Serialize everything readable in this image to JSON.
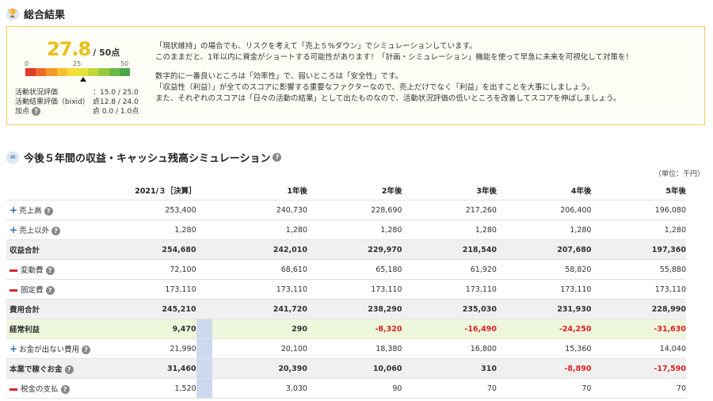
{
  "summary": {
    "title": "総合結果",
    "score": "27.8",
    "score_suffix": "/ 50点",
    "gauge_min": "0",
    "gauge_mid": "25",
    "gauge_max": "50",
    "score_fraction": 0.556,
    "metrics": [
      {
        "label": "活動状況評価",
        "value": "：15.0 / 25.0点"
      },
      {
        "label": "活動結果評価（bixid）",
        "value": "：12.8 / 24.0点"
      },
      {
        "label": "加点",
        "value": "：  0.0 /  1.0点"
      }
    ],
    "messages": [
      "「現状維持」の場合でも、リスクを考えて「売上５%ダウン」でシミュレーションしています。",
      "このままだと、1年以内に資金がショートする可能性があります！「計画・シミュレーション」機能を使って早急に未来を可視化して対策を！",
      "",
      "数字的に一番良いところは「効率性」で、弱いところは「安全性」です。",
      "「収益性（利益）」が全てのスコアに影響する重要なファクターなので、売上だけでなく「利益」を出すことを大事にしましょう。",
      "また、それぞれのスコアは「日々の活動の結果」として出たものなので、活動状況評価の低いところを改善してスコアを伸ばしましょう。"
    ]
  },
  "simulation": {
    "title": "今後５年間の収益・キャッシュ残高シミュレーション",
    "unit": "（単位：千円）",
    "headers": [
      "2021/３［決算］",
      "1年後",
      "2年後",
      "3年後",
      "4年後",
      "5年後"
    ],
    "rows": [
      {
        "label": "売上高",
        "icon": "plus",
        "help": true,
        "style": "",
        "values": [
          "253,400",
          "240,730",
          "228,690",
          "217,260",
          "206,400",
          "196,080"
        ]
      },
      {
        "label": "売上以外",
        "icon": "plus",
        "help": true,
        "style": "",
        "values": [
          "1,280",
          "1,280",
          "1,280",
          "1,280",
          "1,280",
          "1,280"
        ]
      },
      {
        "label": "収益合計",
        "icon": "",
        "help": false,
        "style": "gray",
        "values": [
          "254,680",
          "242,010",
          "229,970",
          "218,540",
          "207,680",
          "197,360"
        ]
      },
      {
        "label": "変動費",
        "icon": "minus",
        "help": true,
        "style": "",
        "values": [
          "72,100",
          "68,610",
          "65,180",
          "61,920",
          "58,820",
          "55,880"
        ]
      },
      {
        "label": "固定費",
        "icon": "minus",
        "help": true,
        "style": "",
        "values": [
          "173,110",
          "173,110",
          "173,110",
          "173,110",
          "173,110",
          "173,110"
        ]
      },
      {
        "label": "費用合計",
        "icon": "",
        "help": false,
        "style": "gray",
        "values": [
          "245,210",
          "241,720",
          "238,290",
          "235,030",
          "231,930",
          "228,990"
        ]
      },
      {
        "label": "経常利益",
        "icon": "",
        "help": false,
        "style": "green",
        "values": [
          "9,470",
          "290",
          "-8,320",
          "-16,490",
          "-24,250",
          "-31,630"
        ]
      },
      {
        "label": "お金が出ない費用",
        "icon": "plus",
        "help": true,
        "style": "",
        "values": [
          "21,990",
          "20,100",
          "18,380",
          "16,800",
          "15,360",
          "14,040"
        ]
      },
      {
        "label": "本業で稼ぐお金",
        "icon": "",
        "help": true,
        "style": "gray",
        "values": [
          "31,460",
          "20,390",
          "10,060",
          "310",
          "-8,890",
          "-17,590"
        ]
      },
      {
        "label": "税金の支払",
        "icon": "minus",
        "help": true,
        "style": "",
        "values": [
          "1,520",
          "3,030",
          "90",
          "70",
          "70",
          "70"
        ]
      }
    ]
  },
  "colors": {
    "accent": "#f2cc5d",
    "score": "#e8c21a",
    "negative": "#e02020",
    "profit_row": "#eef7dc",
    "highlight_col": "#cdd9ee"
  }
}
